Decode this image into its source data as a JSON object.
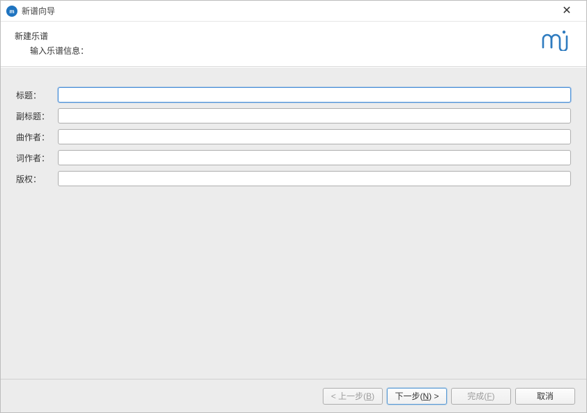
{
  "window": {
    "title": "新谱向导",
    "app_icon_text": "mͧ"
  },
  "header": {
    "title": "新建乐谱",
    "subtitle": "输入乐谱信息："
  },
  "fields": {
    "title": {
      "label": "标题：",
      "value": ""
    },
    "subtitle": {
      "label": "副标题：",
      "value": ""
    },
    "composer": {
      "label": "曲作者：",
      "value": ""
    },
    "lyricist": {
      "label": "词作者：",
      "value": ""
    },
    "copyright": {
      "label": "版权：",
      "value": ""
    }
  },
  "buttons": {
    "back_prefix": "< 上一步(",
    "back_mn": "B",
    "back_suffix": ")",
    "next_prefix": "下一步(",
    "next_mn": "N",
    "next_suffix": ") >",
    "finish_prefix": "完成(",
    "finish_mn": "F",
    "finish_suffix": ")",
    "cancel": "取消"
  }
}
